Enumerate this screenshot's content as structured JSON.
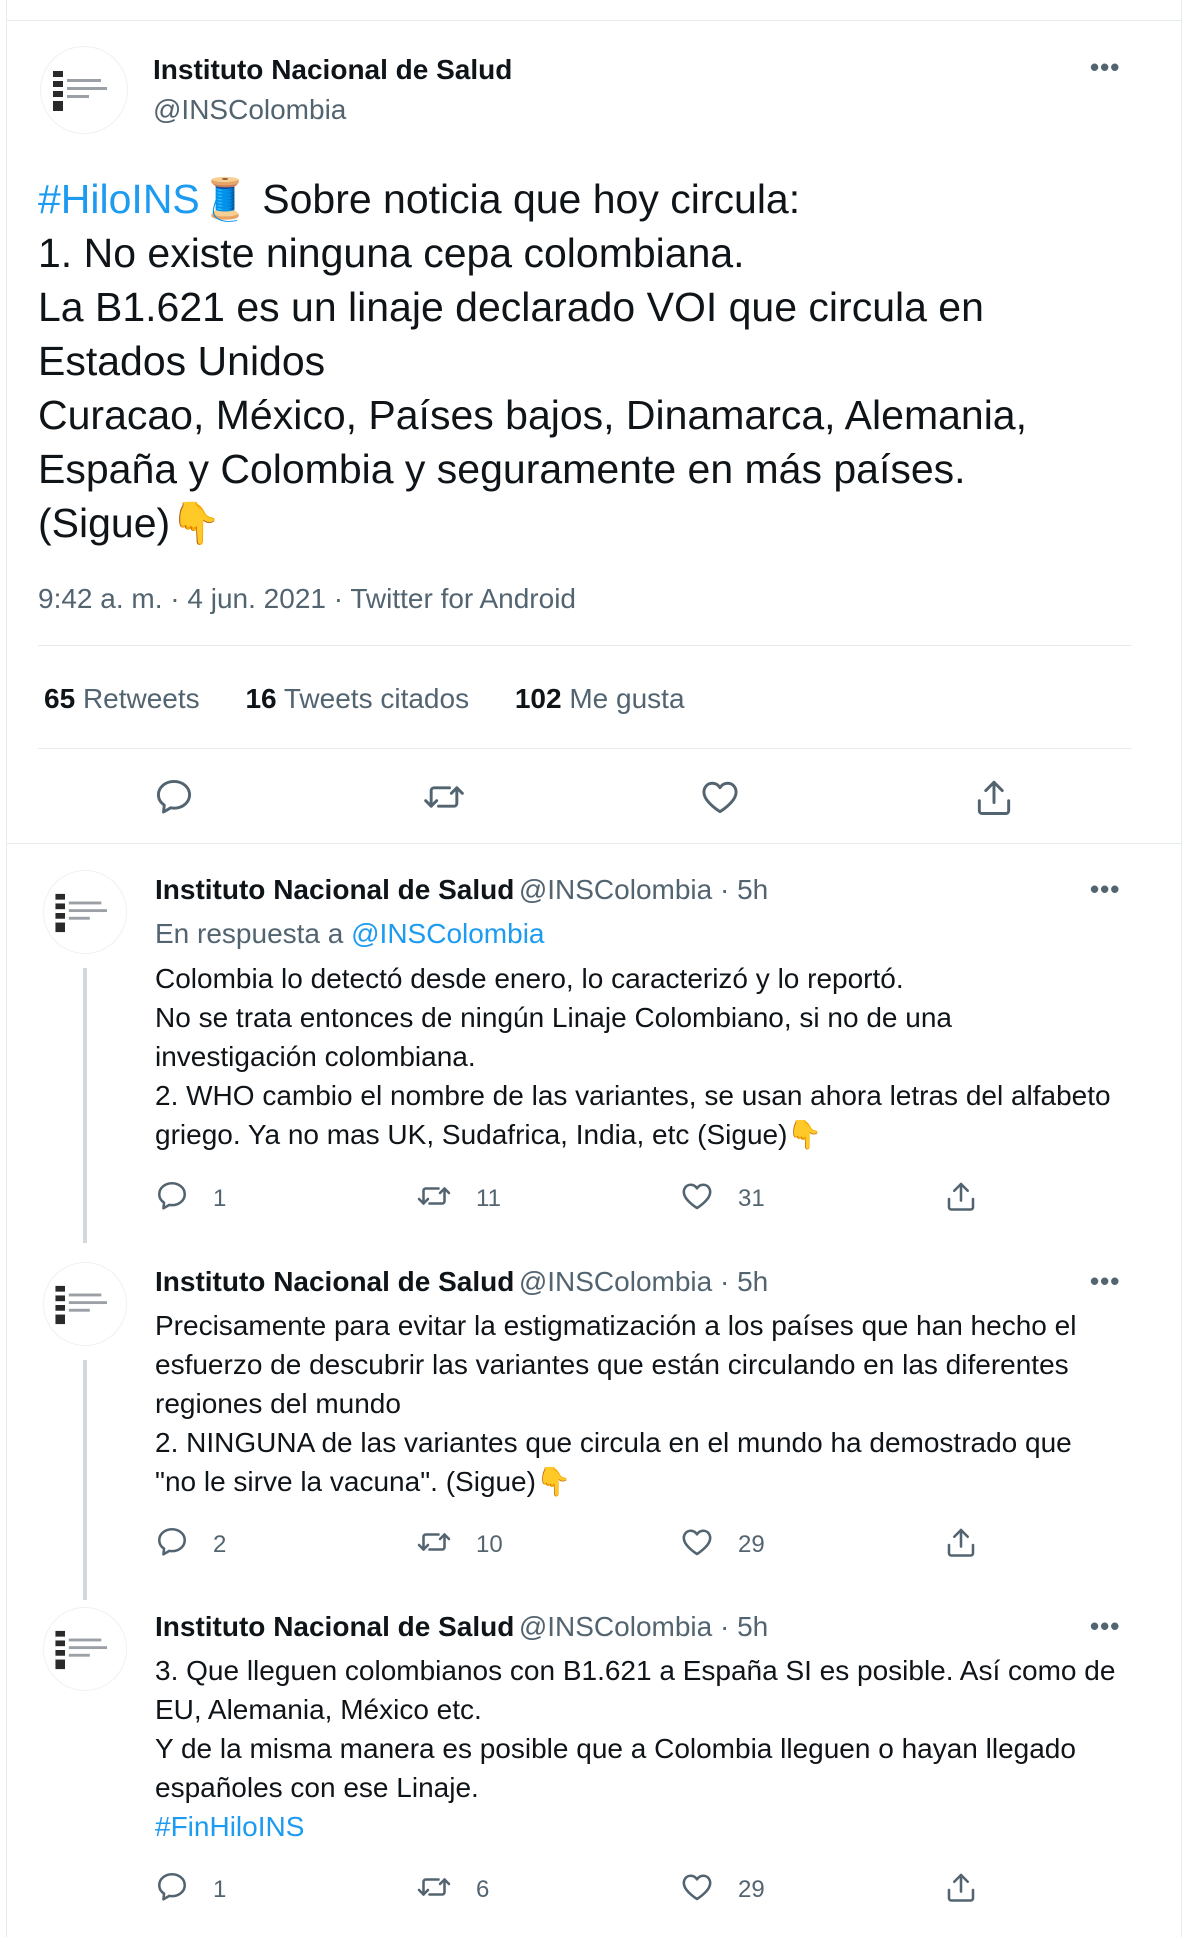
{
  "main_tweet": {
    "author_name": "Instituto Nacional de Salud",
    "author_handle": "@INSColombia",
    "avatar_text": "Instituto Nacional de Salud",
    "hashtag": "#HiloINS",
    "thread_emoji": "🧵",
    "lines": [
      "Sobre noticia que hoy circula:",
      "1. No existe ninguna cepa colombiana.",
      "La B1.621 es un linaje declarado VOI que circula en",
      "Estados Unidos",
      "Curacao, México, Países bajos, Dinamarca, Alemania,",
      "España y Colombia y seguramente en más países.",
      "(Sigue)"
    ],
    "pointing_emoji": "👇",
    "timestamp": "9:42 a. m. · 4 jun. 2021 · Twitter for Android",
    "stats": {
      "retweets_count": "65",
      "retweets_label": "Retweets",
      "quotes_count": "16",
      "quotes_label": "Tweets citados",
      "likes_count": "102",
      "likes_label": "Me gusta"
    }
  },
  "replies": [
    {
      "author_name": "Instituto Nacional de Salud",
      "author_handle": "@INSColombia · 5h",
      "reply_to_label": "En respuesta a",
      "reply_to_handle": "@INSColombia",
      "lines": [
        "Colombia lo detectó desde enero, lo caracterizó y lo reportó.",
        "No se trata entonces de ningún Linaje Colombiano, si no de una",
        "investigación colombiana.",
        "2. WHO cambio el nombre de las variantes, se usan ahora letras del alfabeto",
        "griego. Ya no mas UK, Sudafrica, India, etc (Sigue)"
      ],
      "emoji": "👇",
      "reply_count": "1",
      "retweet_count": "11",
      "like_count": "31"
    },
    {
      "author_name": "Instituto Nacional de Salud",
      "author_handle": "@INSColombia · 5h",
      "lines": [
        "Precisamente para evitar la estigmatización a los países que han hecho el",
        "esfuerzo de descubrir las variantes que están circulando en las diferentes",
        "regiones del mundo",
        "2. NINGUNA de las variantes que circula en el mundo ha demostrado que",
        "\"no le sirve la vacuna\". (Sigue)"
      ],
      "emoji": "👇",
      "reply_count": "2",
      "retweet_count": "10",
      "like_count": "29"
    },
    {
      "author_name": "Instituto Nacional de Salud",
      "author_handle": "@INSColombia · 5h",
      "lines": [
        "3. Que lleguen colombianos con B1.621 a España SI es posible. Así como de",
        "EU, Alemania, México etc.",
        "Y de la misma manera es posible que a Colombia lleguen o hayan llegado",
        "españoles con ese Linaje."
      ],
      "hashtag": "#FinHiloINS",
      "reply_count": "1",
      "retweet_count": "6",
      "like_count": "29"
    }
  ],
  "colors": {
    "accent": "#1d9bf0",
    "text": "#0f1419",
    "muted": "#536471",
    "divider": "#e6ecf0",
    "thread_line": "#cfd9de"
  },
  "icons": {
    "more": "more-icon",
    "reply": "reply-icon",
    "retweet": "retweet-icon",
    "like": "heart-icon",
    "share": "share-icon"
  }
}
